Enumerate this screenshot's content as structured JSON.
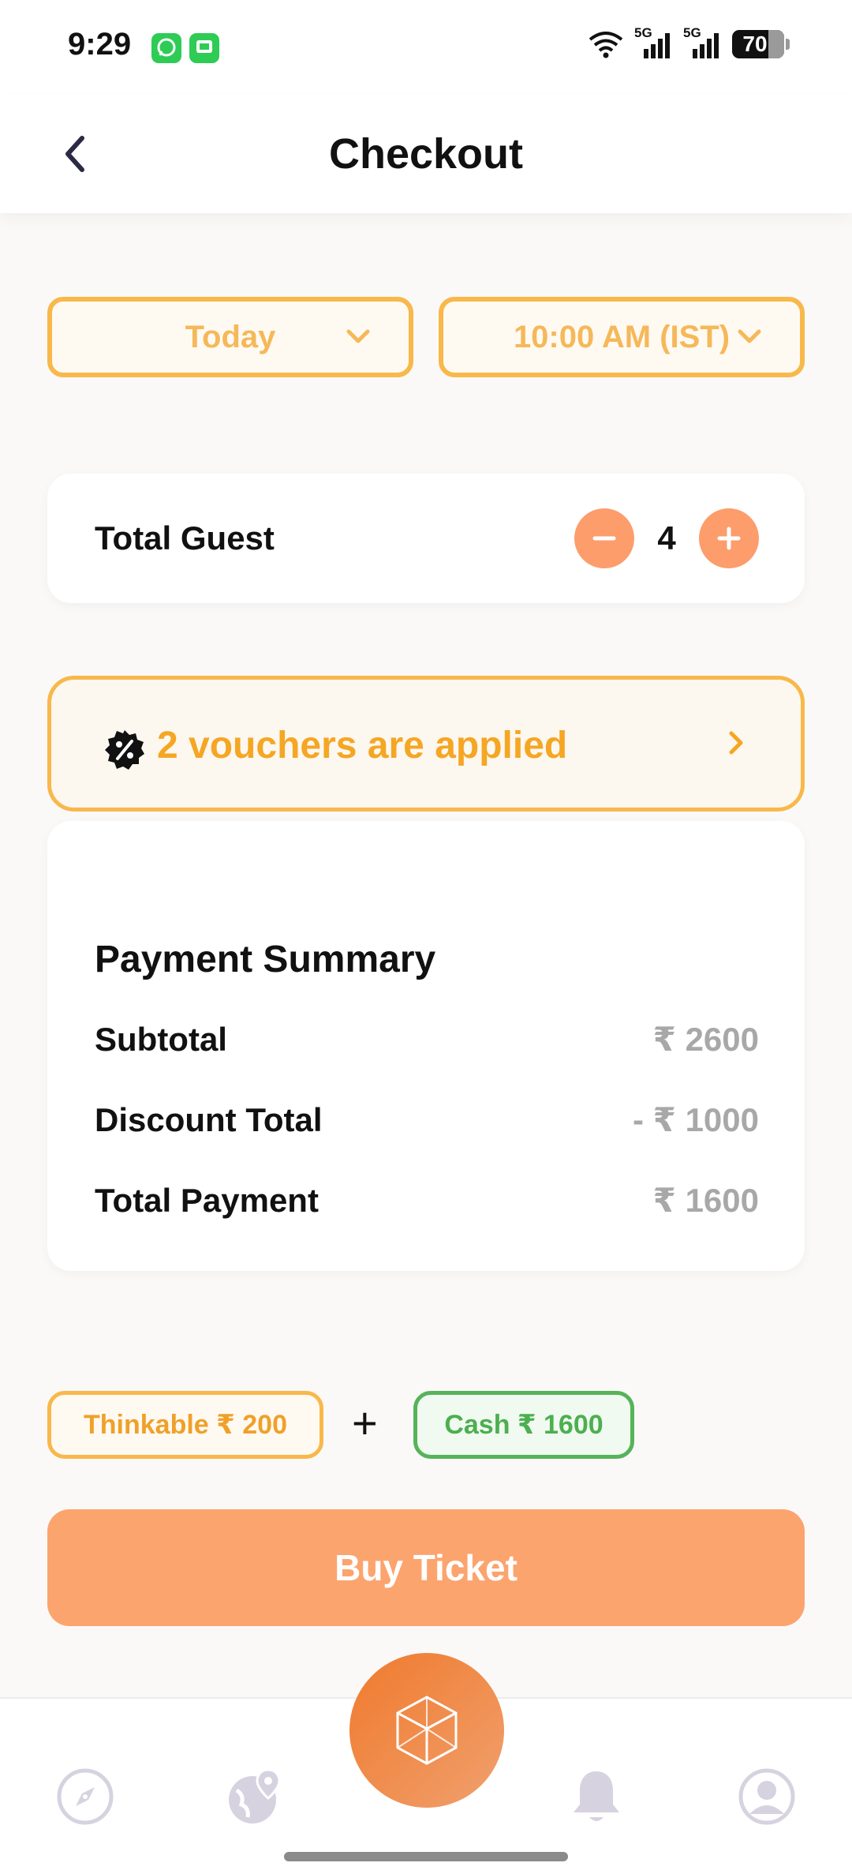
{
  "status_bar": {
    "time": "9:29",
    "notifications": [
      "whatsapp-icon",
      "messages-icon"
    ],
    "network_1": "5G",
    "network_2": "5G",
    "battery": "70"
  },
  "header": {
    "title": "Checkout",
    "back_icon": "chevron-left-icon"
  },
  "selectors": {
    "date": "Today",
    "time": "10:00 AM (IST)"
  },
  "guests": {
    "label": "Total Guest",
    "count": "4"
  },
  "voucher": {
    "text": "2 vouchers are applied"
  },
  "payment_summary": {
    "title": "Payment Summary",
    "rows": [
      {
        "label": "Subtotal",
        "value": "₹ 2600"
      },
      {
        "label": "Discount Total",
        "value": "- ₹ 1000"
      },
      {
        "label": "Total Payment",
        "value": "₹ 1600"
      }
    ]
  },
  "payment_split": {
    "thinkable": "Thinkable ₹ 200",
    "plus": "+",
    "cash": "Cash ₹ 1600"
  },
  "buy_button": "Buy Ticket",
  "bottom_nav": {
    "items": [
      "compass-icon",
      "globe-pin-icon",
      "cube-icon",
      "bell-icon",
      "profile-icon"
    ]
  },
  "colors": {
    "accent_orange": "#fca46e",
    "voucher_yellow": "#f8b84a",
    "cash_green": "#57b35a"
  }
}
